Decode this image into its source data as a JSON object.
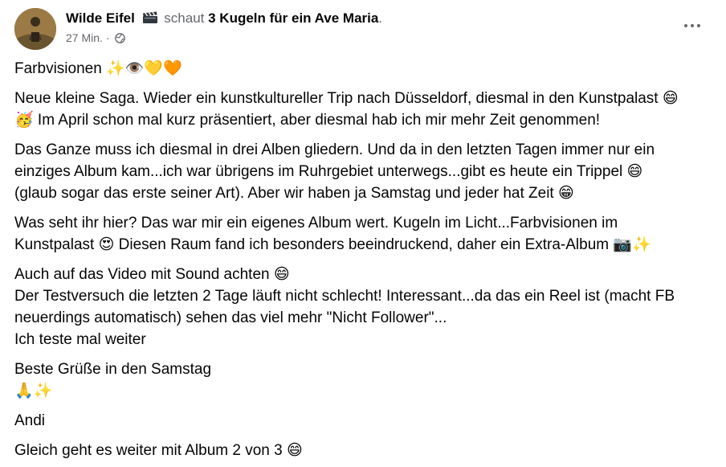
{
  "header": {
    "author": "Wilde Eifel",
    "activity_icon": "clapper-board-icon",
    "action": "schaut",
    "target": "3 Kugeln für ein Ave Maria",
    "period": ".",
    "time": "27 Min.",
    "separator": "·",
    "audience_icon": "globe-icon"
  },
  "post": {
    "paragraphs": [
      "Farbvisionen ✨👁️💛🧡",
      "Neue kleine Saga. Wieder ein kunstkultureller Trip nach Düsseldorf, diesmal in den Kunstpalast 😄\n🥳 Im April schon mal kurz präsentiert, aber diesmal hab ich mir mehr Zeit genommen!",
      "Das Ganze muss ich diesmal in drei Alben gliedern. Und da in den letzten Tagen immer nur ein\neinziges Album kam...ich war übrigens im Ruhrgebiet unterwegs...gibt es heute ein Trippel 😄\n(glaub sogar das erste seiner Art). Aber wir haben ja Samstag und jeder hat Zeit 😁",
      "Was seht ihr hier? Das war mir ein eigenes Album wert. Kugeln im Licht...Farbvisionen im\nKunstpalast 😍 Diesen Raum fand ich besonders beeindruckend, daher ein Extra-Album 📷✨",
      "Auch auf das Video mit Sound achten 😄\nDer Testversuch die letzten 2 Tage läuft nicht schlecht! Interessant...da das ein Reel ist (macht FB\nneuerdings automatisch) sehen das viel mehr \"Nicht Follower\"...\nIch teste mal weiter",
      "Beste Grüße in den Samstag\n🙏✨",
      "Andi",
      "Gleich geht es weiter mit Album 2 von 3 😄"
    ]
  },
  "colors": {
    "text_primary": "#050505",
    "text_secondary": "#65676b",
    "background": "#ffffff"
  }
}
